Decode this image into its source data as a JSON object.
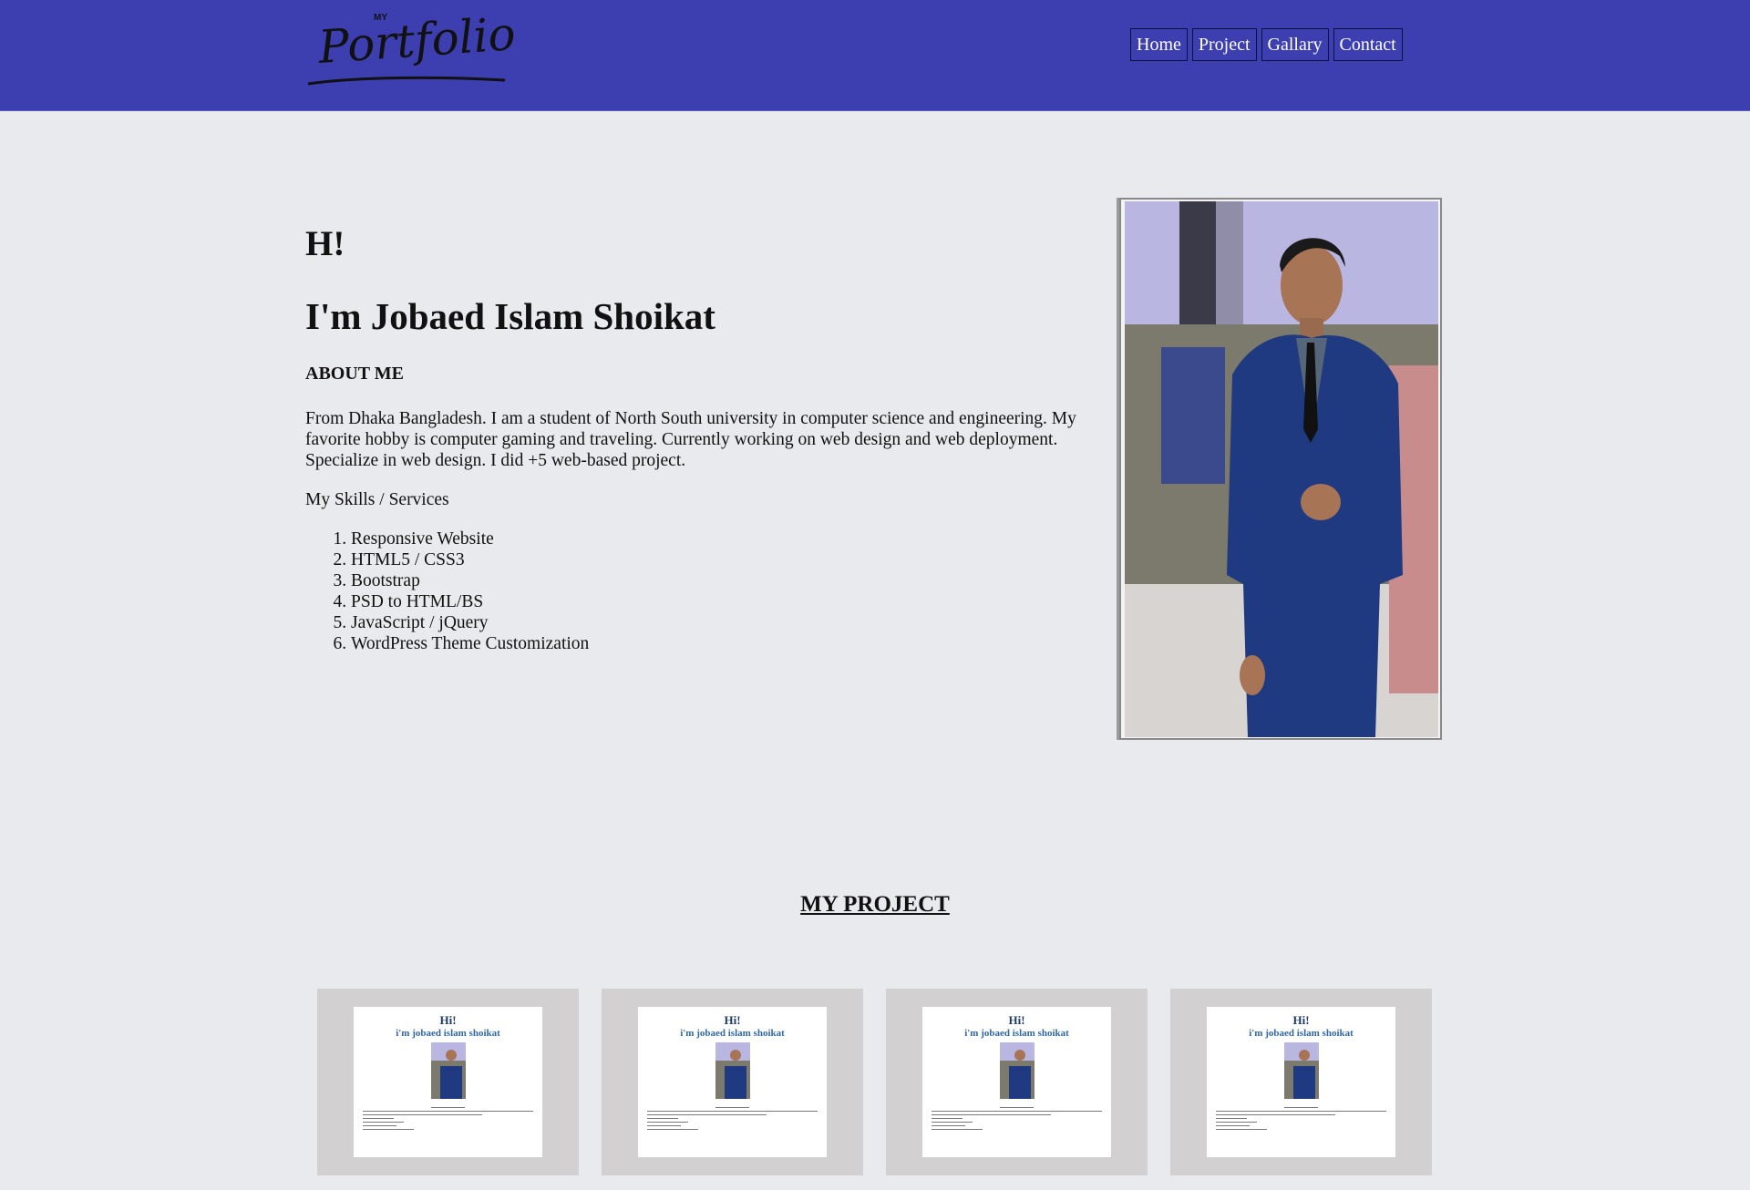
{
  "navbar": {
    "logo": {
      "small_text": "MY",
      "script_text": "Portfolio"
    },
    "links": [
      "Home",
      "Project",
      "Gallary",
      "Contact"
    ],
    "background_color": "#3d3fb1"
  },
  "hero": {
    "greeting": "H!",
    "name": "I'm Jobaed Islam Shoikat",
    "about_heading": "ABOUT ME",
    "about_text": "From Dhaka Bangladesh. I am a student of North South university in computer science and engineering. My favorite hobby is computer gaming and traveling. Currently working on web design and web deployment. Specialize in web design. I did +5 web-based project.",
    "skills_heading": "My Skills / Services",
    "skills": [
      "Responsive Website",
      "HTML5 / CSS3",
      "Bootstrap",
      "PSD to HTML/BS",
      "JavaScript / jQuery",
      "WordPress Theme Customization"
    ]
  },
  "projects": {
    "title": "MY PROJECT",
    "cards": [
      {
        "hi": "Hi!",
        "name": "i'm jobaed islam shoikat"
      },
      {
        "hi": "Hi!",
        "name": "i'm jobaed islam shoikat"
      },
      {
        "hi": "Hi!",
        "name": "i'm jobaed islam shoikat"
      },
      {
        "hi": "Hi!",
        "name": "i'm jobaed islam shoikat"
      }
    ]
  }
}
